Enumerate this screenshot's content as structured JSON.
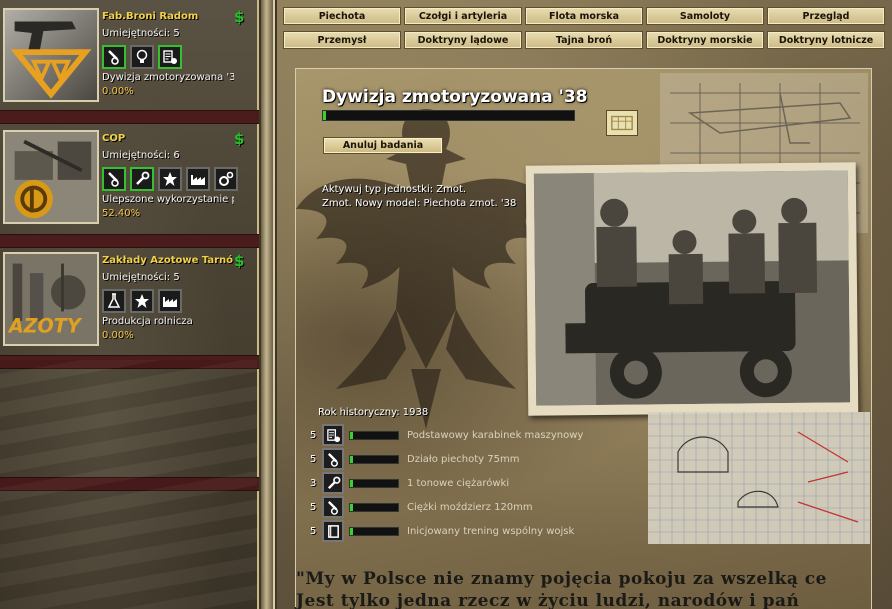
{
  "companies": [
    {
      "name": "Fab.Broni Radom",
      "skill": "Umiejętności: 5",
      "project": "Dywizja zmotoryzowana '3",
      "progress": "0.00%",
      "icons": [
        {
          "name": "artillery-icon",
          "active": true
        },
        {
          "name": "lightbulb-icon",
          "active": false
        },
        {
          "name": "document-gear-icon",
          "active": true
        }
      ]
    },
    {
      "name": "COP",
      "skill": "Umiejętności: 6",
      "project": "Ulepszone wykorzystanie p",
      "progress": "52.40%",
      "icons": [
        {
          "name": "artillery-icon",
          "active": true
        },
        {
          "name": "wrench-icon",
          "active": true
        },
        {
          "name": "star-icon",
          "active": false
        },
        {
          "name": "factory-icon",
          "active": false
        },
        {
          "name": "gears-icon",
          "active": false
        }
      ]
    },
    {
      "name": "Zakłady Azotowe Tarnó",
      "skill": "Umiejętności: 5",
      "project": "Produkcja rolnicza",
      "progress": "0.00%",
      "icons": [
        {
          "name": "flask-icon",
          "active": false
        },
        {
          "name": "star-icon",
          "active": false
        },
        {
          "name": "factory-icon",
          "active": false
        }
      ]
    }
  ],
  "currency_symbol": "$",
  "tabs": [
    "Piechota",
    "Czołgi i artyleria",
    "Flota morska",
    "Samoloty",
    "Przegląd",
    "Przemysł",
    "Doktryny lądowe",
    "Tajna broń",
    "Doktryny morskie",
    "Doktryny lotnicze"
  ],
  "tech": {
    "title": "Dywizja zmotoryzowana '38",
    "cancel_label": "Anuluj badania",
    "effects": [
      "Aktywuj typ jednostki: Zmot.",
      "Zmot. Nowy model: Piechota zmot. '38"
    ],
    "historical_year": "Rok historyczny: 1938",
    "progress_fraction": 0.01
  },
  "requirements": [
    {
      "level": "5",
      "icon": "document-gear-icon",
      "label": "Podstawowy karabinek maszynowy"
    },
    {
      "level": "5",
      "icon": "artillery-icon",
      "label": "Działo piechoty 75mm"
    },
    {
      "level": "3",
      "icon": "wrench-icon",
      "label": "1 tonowe ciężarówki"
    },
    {
      "level": "5",
      "icon": "artillery-icon",
      "label": "Ciężki moździerz 120mm"
    },
    {
      "level": "5",
      "icon": "book-icon",
      "label": "Inicjowany trening wspólny wojsk"
    }
  ],
  "quote": [
    "\"My w Polsce nie znamy pojęcia pokoju za wszelką ce",
    "Jest tylko jedna rzecz w życiu ludzi, narodów i pań"
  ],
  "colors": {
    "accent_green": "#36c030",
    "company_name": "#f2d24a",
    "progress": "#f2c24a",
    "separator": "#4a1c1c"
  }
}
